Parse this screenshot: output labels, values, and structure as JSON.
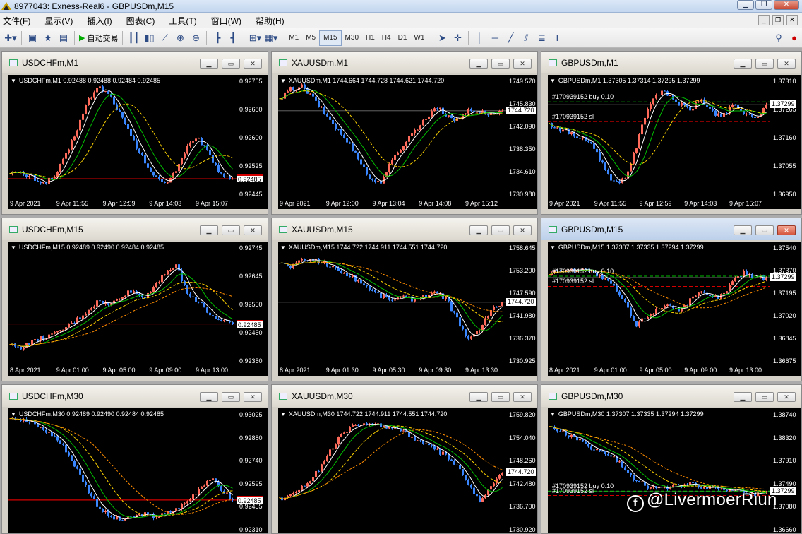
{
  "app": {
    "title": "8977043: Exness-Real6 - GBPUSDm,M15",
    "menu": [
      "文件(F)",
      "显示(V)",
      "插入(I)",
      "图表(C)",
      "工具(T)",
      "窗口(W)",
      "帮助(H)"
    ],
    "autotrade_label": "自动交易",
    "timeframes": [
      "M1",
      "M5",
      "M15",
      "M30",
      "H1",
      "H4",
      "D1",
      "W1"
    ],
    "active_timeframe": "M15"
  },
  "colors": {
    "bull": "#ff6b5a",
    "bear": "#3a86ff",
    "ma_fast": "#ffffff",
    "ma_mid": "#00c000",
    "ma_slow": "#ffd400",
    "ma_long": "#ff8c00",
    "grid_line": "#6f6f6f",
    "price_line_red": "#d40000",
    "order_buy": "#00c000",
    "order_sl": "#d40000"
  },
  "charts": [
    {
      "title": "USDCHFm,M1",
      "ohlc": "USDCHFm,M1  0.92488 0.92488 0.92484 0.92485",
      "yticks": [
        "0.92755",
        "0.92680",
        "0.92600",
        "0.92525",
        "0.92445"
      ],
      "xticks": [
        "9 Apr 2021",
        "9 Apr 11:55",
        "9 Apr 12:59",
        "9 Apr 14:03",
        "9 Apr 15:07"
      ],
      "price_tag": "0.92485",
      "price_tag_red": true,
      "orders": [],
      "chart_data": {
        "type": "candlestick",
        "ylim": [
          0.9242,
          0.9284
        ],
        "last": 0.92485,
        "trend": [
          0.9251,
          0.925,
          0.9249,
          0.9247,
          0.9249,
          0.9256,
          0.9265,
          0.9275,
          0.928,
          0.9277,
          0.927,
          0.9262,
          0.9255,
          0.9249,
          0.9247,
          0.9252,
          0.926,
          0.9262,
          0.9256,
          0.925,
          0.92485
        ]
      }
    },
    {
      "title": "XAUUSDm,M1",
      "ohlc": "XAUUSDm,M1  1744.664 1744.728 1744.621 1744.720",
      "yticks": [
        "1749.570",
        "1745.830",
        "1742.090",
        "1738.350",
        "1734.610",
        "1730.980"
      ],
      "xticks": [
        "9 Apr 2021",
        "9 Apr 12:00",
        "9 Apr 13:04",
        "9 Apr 14:08",
        "9 Apr 15:12"
      ],
      "price_tag": "1744.720",
      "price_tag_red": false,
      "orders": [],
      "chart_data": {
        "type": "candlestick",
        "ylim": [
          1729.5,
          1751.0
        ],
        "last": 1744.72,
        "trend": [
          1746.5,
          1748.5,
          1749.0,
          1747.0,
          1744.5,
          1742.0,
          1739.5,
          1737.0,
          1733.0,
          1732.0,
          1735.5,
          1738.5,
          1741.0,
          1743.0,
          1745.5,
          1744.0,
          1743.0,
          1745.0,
          1744.5,
          1744.2,
          1744.72
        ]
      }
    },
    {
      "title": "GBPUSDm,M1",
      "ohlc": "GBPUSDm,M1  1.37305 1.37314 1.37295 1.37299",
      "yticks": [
        "1.37310",
        "1.37265",
        "1.37160",
        "1.37055",
        "1.36950"
      ],
      "xticks": [
        "9 Apr 2021",
        "9 Apr 11:55",
        "9 Apr 12:59",
        "9 Apr 14:03",
        "9 Apr 15:07"
      ],
      "price_tag": "1.37299",
      "price_tag_red": false,
      "orders": [
        {
          "label": "#170939152 buy 0.10",
          "type": "buy",
          "price": 1.3731
        },
        {
          "label": "#170939152 sl",
          "type": "sl",
          "price": 1.3723
        }
      ],
      "chart_data": {
        "type": "candlestick",
        "ylim": [
          1.3692,
          1.3742
        ],
        "last": 1.37299,
        "trend": [
          1.3722,
          1.372,
          1.3718,
          1.3716,
          1.3714,
          1.3705,
          1.3698,
          1.37,
          1.3712,
          1.3728,
          1.3735,
          1.3734,
          1.373,
          1.3728,
          1.3732,
          1.3727,
          1.3725,
          1.373,
          1.3726,
          1.3724,
          1.37299
        ]
      }
    },
    {
      "title": "USDCHFm,M15",
      "ohlc": "USDCHFm,M15  0.92489 0.92490 0.92484 0.92485",
      "yticks": [
        "0.92745",
        "0.92645",
        "0.92550",
        "0.92450",
        "0.92350"
      ],
      "xticks": [
        "8 Apr 2021",
        "9 Apr 01:00",
        "9 Apr 05:00",
        "9 Apr 09:00",
        "9 Apr 13:00"
      ],
      "price_tag": "0.92485",
      "price_tag_red": true,
      "orders": [],
      "chart_data": {
        "type": "candlestick",
        "ylim": [
          0.9232,
          0.9282
        ],
        "last": 0.92485,
        "trend": [
          0.924,
          0.9239,
          0.9241,
          0.9243,
          0.9244,
          0.9247,
          0.925,
          0.9254,
          0.9258,
          0.9256,
          0.926,
          0.9262,
          0.9259,
          0.9264,
          0.927,
          0.9272,
          0.926,
          0.9258,
          0.9252,
          0.925,
          0.92485
        ]
      }
    },
    {
      "title": "XAUUSDm,M15",
      "ohlc": "XAUUSDm,M15  1744.722 1744.911 1744.551 1744.720",
      "yticks": [
        "1758.645",
        "1753.200",
        "1747.590",
        "1741.980",
        "1736.370",
        "1730.925"
      ],
      "xticks": [
        "8 Apr 2021",
        "9 Apr 01:30",
        "9 Apr 05:30",
        "9 Apr 09:30",
        "9 Apr 13:30"
      ],
      "price_tag": "1744.720",
      "price_tag_red": false,
      "orders": [],
      "chart_data": {
        "type": "candlestick",
        "ylim": [
          1728.5,
          1760.5
        ],
        "last": 1744.72,
        "trend": [
          1755.0,
          1754.0,
          1755.5,
          1756.0,
          1755.0,
          1753.5,
          1752.0,
          1750.5,
          1748.5,
          1746.5,
          1745.5,
          1746.0,
          1745.5,
          1746.5,
          1747.0,
          1745.5,
          1740.0,
          1734.5,
          1738.0,
          1742.5,
          1744.72
        ]
      }
    },
    {
      "title": "GBPUSDm,M15",
      "ohlc": "GBPUSDm,M15  1.37307 1.37335 1.37294 1.37299",
      "yticks": [
        "1.37540",
        "1.37370",
        "1.37195",
        "1.37020",
        "1.36845",
        "1.36675"
      ],
      "xticks": [
        "8 Apr 2021",
        "9 Apr 01:00",
        "9 Apr 05:00",
        "9 Apr 09:00",
        "9 Apr 13:00"
      ],
      "price_tag": "1.37299",
      "price_tag_red": false,
      "orders": [
        {
          "label": "#170939152 buy 0.10",
          "type": "buy",
          "price": 1.3731
        },
        {
          "label": "#170939152 sl",
          "type": "sl",
          "price": 1.3723
        }
      ],
      "chart_data": {
        "type": "candlestick",
        "ylim": [
          1.3662,
          1.3758
        ],
        "last": 1.37299,
        "trend": [
          1.3733,
          1.3736,
          1.3735,
          1.3738,
          1.3734,
          1.3729,
          1.3722,
          1.371,
          1.3692,
          1.37,
          1.3705,
          1.371,
          1.3704,
          1.3712,
          1.3718,
          1.3714,
          1.3716,
          1.3728,
          1.3734,
          1.373,
          1.37299
        ]
      }
    },
    {
      "title": "USDCHFm,M30",
      "ohlc": "USDCHFm,M30  0.92489 0.92490 0.92484 0.92485",
      "yticks": [
        "0.93025",
        "0.92880",
        "0.92740",
        "0.92595",
        "0.92455",
        "0.92310"
      ],
      "xticks": [],
      "price_tag": "0.92485",
      "price_tag_red": true,
      "orders": [],
      "chart_data": {
        "type": "candlestick",
        "ylim": [
          0.9228,
          0.9305
        ],
        "last": 0.92485,
        "trend": [
          0.93,
          0.9298,
          0.9296,
          0.9292,
          0.9288,
          0.928,
          0.9268,
          0.9255,
          0.9244,
          0.9238,
          0.9236,
          0.9238,
          0.924,
          0.9238,
          0.924,
          0.9243,
          0.9248,
          0.9256,
          0.9262,
          0.9255,
          0.92485
        ]
      }
    },
    {
      "title": "XAUUSDm,M30",
      "ohlc": "XAUUSDm,M30  1744.722 1744.911 1744.551 1744.720",
      "yticks": [
        "1759.820",
        "1754.040",
        "1748.260",
        "1742.480",
        "1736.700",
        "1730.920"
      ],
      "xticks": [],
      "price_tag": "1744.720",
      "price_tag_red": false,
      "orders": [],
      "chart_data": {
        "type": "candlestick",
        "ylim": [
          1729.5,
          1761.0
        ],
        "last": 1744.72,
        "trend": [
          1738.0,
          1739.5,
          1741.0,
          1743.5,
          1747.5,
          1752.0,
          1755.5,
          1757.0,
          1756.5,
          1757.0,
          1756.0,
          1755.5,
          1753.5,
          1752.0,
          1750.5,
          1749.0,
          1746.0,
          1742.0,
          1737.0,
          1741.5,
          1744.72
        ]
      }
    },
    {
      "title": "GBPUSDm,M30",
      "ohlc": "GBPUSDm,M30  1.37307 1.37335 1.37294 1.37299",
      "yticks": [
        "1.38740",
        "1.38320",
        "1.37910",
        "1.37490",
        "1.37080",
        "1.36660"
      ],
      "xticks": [],
      "price_tag": "1.37299",
      "price_tag_red": false,
      "orders": [
        {
          "label": "#170939152 buy 0.10",
          "type": "buy",
          "price": 1.3731
        },
        {
          "label": "#170939152 sl",
          "type": "sl",
          "price": 1.3723
        }
      ],
      "chart_data": {
        "type": "candlestick",
        "ylim": [
          1.3655,
          1.388
        ],
        "last": 1.37299,
        "trend": [
          1.3845,
          1.384,
          1.383,
          1.382,
          1.3808,
          1.38,
          1.379,
          1.377,
          1.375,
          1.374,
          1.3738,
          1.3735,
          1.3742,
          1.3745,
          1.374,
          1.3738,
          1.3735,
          1.3732,
          1.3728,
          1.3726,
          1.37299
        ]
      }
    }
  ],
  "watermark": "@LivermoerRiun"
}
